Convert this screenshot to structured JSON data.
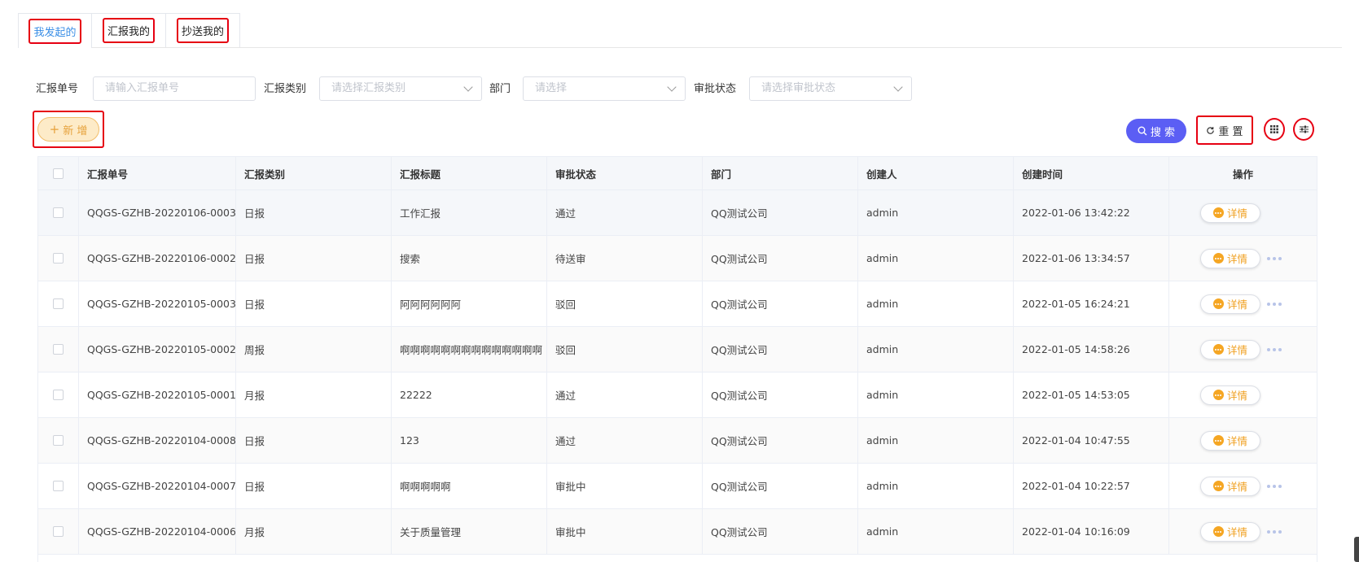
{
  "tabs": [
    {
      "label": "我发起的",
      "active": true
    },
    {
      "label": "汇报我的",
      "active": false
    },
    {
      "label": "抄送我的",
      "active": false
    }
  ],
  "filters": {
    "report_no_label": "汇报单号",
    "report_no_placeholder": "请输入汇报单号",
    "type_label": "汇报类别",
    "type_placeholder": "请选择汇报类别",
    "dept_label": "部门",
    "dept_placeholder": "请选择",
    "status_label": "审批状态",
    "status_placeholder": "请选择审批状态"
  },
  "toolbar": {
    "add_label": "新 增",
    "search_label": "搜 索",
    "reset_label": "重 置"
  },
  "table": {
    "columns": [
      "汇报单号",
      "汇报类别",
      "汇报标题",
      "审批状态",
      "部门",
      "创建人",
      "创建时间",
      "操作"
    ],
    "detail_label": "详情",
    "rows": [
      {
        "no": "QQGS-GZHB-20220106-0003",
        "type": "日报",
        "title": "工作汇报",
        "status": "通过",
        "dept": "QQ测试公司",
        "creator": "admin",
        "time": "2022-01-06 13:42:22",
        "more": false
      },
      {
        "no": "QQGS-GZHB-20220106-0002",
        "type": "日报",
        "title": "搜索",
        "status": "待送审",
        "dept": "QQ测试公司",
        "creator": "admin",
        "time": "2022-01-06 13:34:57",
        "more": true
      },
      {
        "no": "QQGS-GZHB-20220105-0003",
        "type": "日报",
        "title": "阿阿阿阿阿阿",
        "status": "驳回",
        "dept": "QQ测试公司",
        "creator": "admin",
        "time": "2022-01-05 16:24:21",
        "more": true
      },
      {
        "no": "QQGS-GZHB-20220105-0002",
        "type": "周报",
        "title": "啊啊啊啊啊啊啊啊啊啊啊啊啊啊",
        "status": "驳回",
        "dept": "QQ测试公司",
        "creator": "admin",
        "time": "2022-01-05 14:58:26",
        "more": true
      },
      {
        "no": "QQGS-GZHB-20220105-0001",
        "type": "月报",
        "title": "22222",
        "status": "通过",
        "dept": "QQ测试公司",
        "creator": "admin",
        "time": "2022-01-05 14:53:05",
        "more": false
      },
      {
        "no": "QQGS-GZHB-20220104-0008",
        "type": "日报",
        "title": "123",
        "status": "通过",
        "dept": "QQ测试公司",
        "creator": "admin",
        "time": "2022-01-04 10:47:55",
        "more": false
      },
      {
        "no": "QQGS-GZHB-20220104-0007",
        "type": "日报",
        "title": "啊啊啊啊啊",
        "status": "审批中",
        "dept": "QQ测试公司",
        "creator": "admin",
        "time": "2022-01-04 10:22:57",
        "more": true
      },
      {
        "no": "QQGS-GZHB-20220104-0006",
        "type": "月报",
        "title": "关于质量管理",
        "status": "审批中",
        "dept": "QQ测试公司",
        "creator": "admin",
        "time": "2022-01-04 10:16:09",
        "more": true
      }
    ]
  },
  "colors": {
    "accent": "#5b5ef4",
    "tab_active": "#3a8ee6",
    "warning": "#f0a020",
    "highlight_box": "#e60012"
  }
}
